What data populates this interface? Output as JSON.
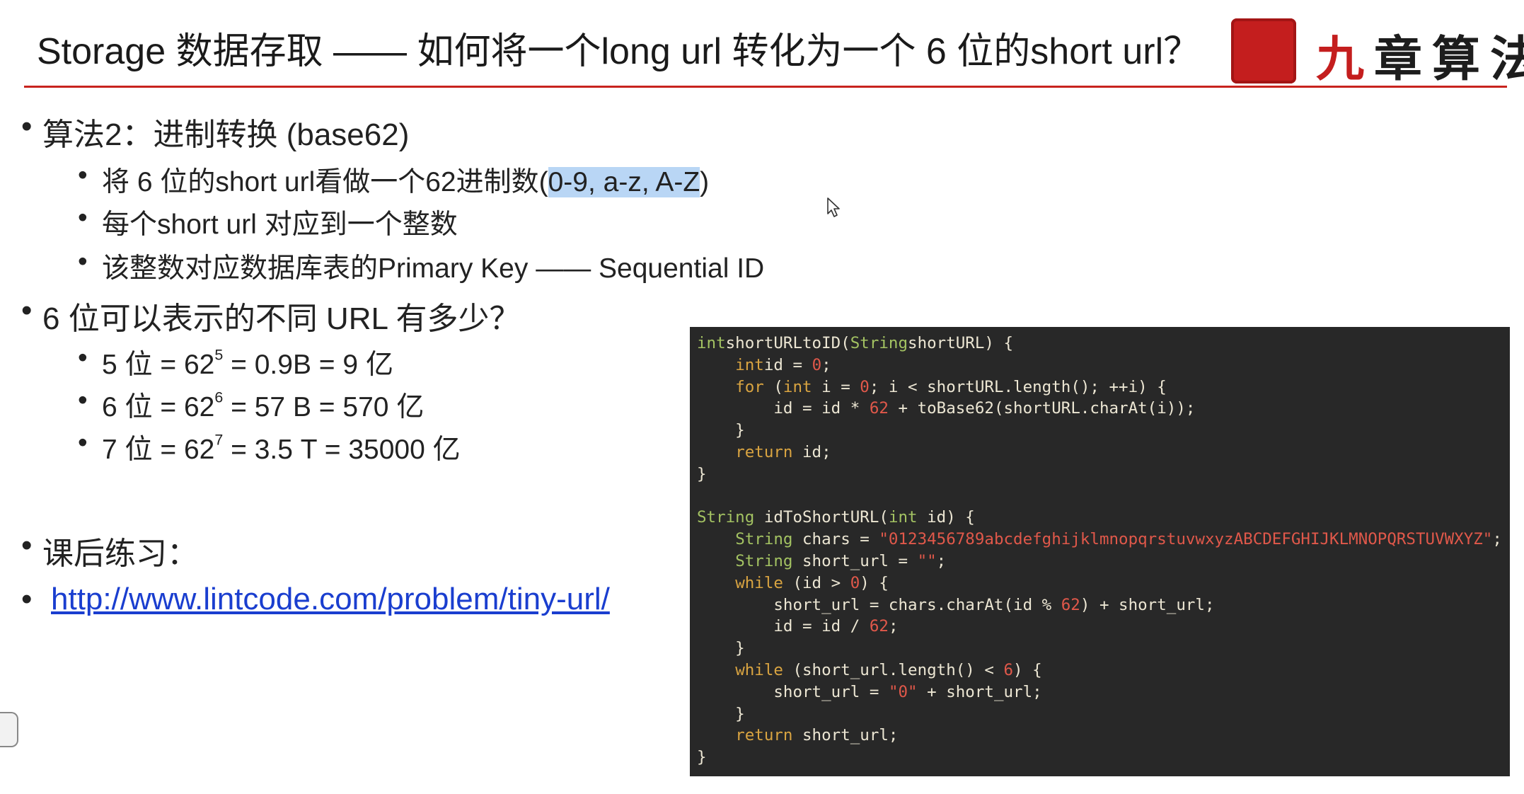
{
  "slide": {
    "title": "Storage 数据存取 —— 如何将一个long url 转化为一个 6 位的short url？",
    "logo_text": "九章算法",
    "logo_first_char": "九",
    "logo_rest": "章算法",
    "accent_color": "#c8231e"
  },
  "content": {
    "algo_heading": "算法2：进制转换 (base62)",
    "algo_points": {
      "p1_prefix": "将 6 位的short url看做一个62进制数(",
      "p1_highlight": "0-9, a-z, A-Z",
      "p1_suffix": ")",
      "p2": "每个short url 对应到一个整数",
      "p3": "该整数对应数据库表的Primary Key —— Sequential ID"
    },
    "count_heading": "6 位可以表示的不同 URL 有多少？",
    "counts": [
      {
        "prefix": "5 位 = 62",
        "exp": "5",
        "suffix": " = 0.9B = 9 亿"
      },
      {
        "prefix": "6 位 = 62",
        "exp": "6",
        "suffix": " = 57 B = 570 亿"
      },
      {
        "prefix": "7 位 = 62",
        "exp": "7",
        "suffix": " = 3.5 T = 35000 亿"
      }
    ],
    "homework_heading": "课后练习：",
    "homework_link": "http://www.lintcode.com/problem/tiny-url/"
  },
  "code": {
    "language": "java",
    "lines": [
      [
        [
          "ty",
          "int"
        ],
        [
          "",
          "shortURLtoID("
        ],
        [
          "ty",
          "String"
        ],
        [
          "",
          "shortURL) {"
        ]
      ],
      [
        [
          "",
          "    "
        ],
        [
          "kw",
          "int"
        ],
        [
          "",
          "id = "
        ],
        [
          "num",
          "0"
        ],
        [
          "",
          ";"
        ]
      ],
      [
        [
          "",
          "    "
        ],
        [
          "kw",
          "for"
        ],
        [
          "",
          " ("
        ],
        [
          "kw",
          "int"
        ],
        [
          "",
          " i = "
        ],
        [
          "num",
          "0"
        ],
        [
          "",
          "; i < shortURL.length(); ++i) {"
        ]
      ],
      [
        [
          "",
          "        id = id * "
        ],
        [
          "num",
          "62"
        ],
        [
          "",
          " + toBase62(shortURL.charAt(i));"
        ]
      ],
      [
        [
          "",
          "    }"
        ]
      ],
      [
        [
          "",
          "    "
        ],
        [
          "kw",
          "return"
        ],
        [
          "",
          " id;"
        ]
      ],
      [
        [
          "",
          "}"
        ]
      ],
      [
        [
          "",
          ""
        ]
      ],
      [
        [
          "ty",
          "String"
        ],
        [
          "",
          " idToShortURL("
        ],
        [
          "ty",
          "int"
        ],
        [
          "",
          " id) {"
        ]
      ],
      [
        [
          "",
          "    "
        ],
        [
          "ty",
          "String"
        ],
        [
          "",
          " chars = "
        ],
        [
          "str",
          "\"0123456789abcdefghijklmnopqrstuvwxyzABCDEFGHIJKLMNOPQRSTUVWXYZ\""
        ],
        [
          "",
          ";"
        ]
      ],
      [
        [
          "",
          "    "
        ],
        [
          "ty",
          "String"
        ],
        [
          "",
          " short_url = "
        ],
        [
          "str",
          "\"\""
        ],
        [
          "",
          ";"
        ]
      ],
      [
        [
          "",
          "    "
        ],
        [
          "kw",
          "while"
        ],
        [
          "",
          " (id > "
        ],
        [
          "num",
          "0"
        ],
        [
          "",
          ") {"
        ]
      ],
      [
        [
          "",
          "        short_url = chars.charAt(id % "
        ],
        [
          "num",
          "62"
        ],
        [
          "",
          ") + short_url;"
        ]
      ],
      [
        [
          "",
          "        id = id / "
        ],
        [
          "num",
          "62"
        ],
        [
          "",
          ";"
        ]
      ],
      [
        [
          "",
          "    }"
        ]
      ],
      [
        [
          "",
          "    "
        ],
        [
          "kw",
          "while"
        ],
        [
          "",
          " (short_url.length() < "
        ],
        [
          "num",
          "6"
        ],
        [
          "",
          ") {"
        ]
      ],
      [
        [
          "",
          "        short_url = "
        ],
        [
          "str",
          "\"0\""
        ],
        [
          "",
          " + short_url;"
        ]
      ],
      [
        [
          "",
          "    }"
        ]
      ],
      [
        [
          "",
          "    "
        ],
        [
          "kw",
          "return"
        ],
        [
          "",
          " short_url;"
        ]
      ],
      [
        [
          "",
          "}"
        ]
      ]
    ]
  }
}
